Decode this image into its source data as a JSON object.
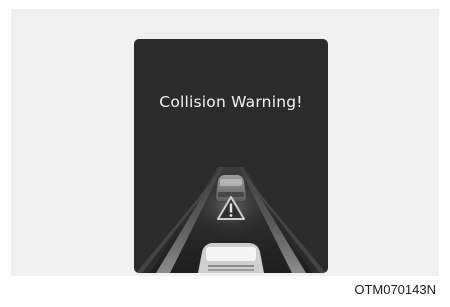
{
  "display": {
    "warning_text": "Collision Warning!"
  },
  "caption": "OTM070143N",
  "colors": {
    "screen_background": "#2b2b2b",
    "frame_background": "#f0f0f0",
    "text": "#f3f3f3"
  },
  "icons": [
    "warning-triangle-icon",
    "front-vehicle-icon",
    "own-vehicle-icon"
  ]
}
